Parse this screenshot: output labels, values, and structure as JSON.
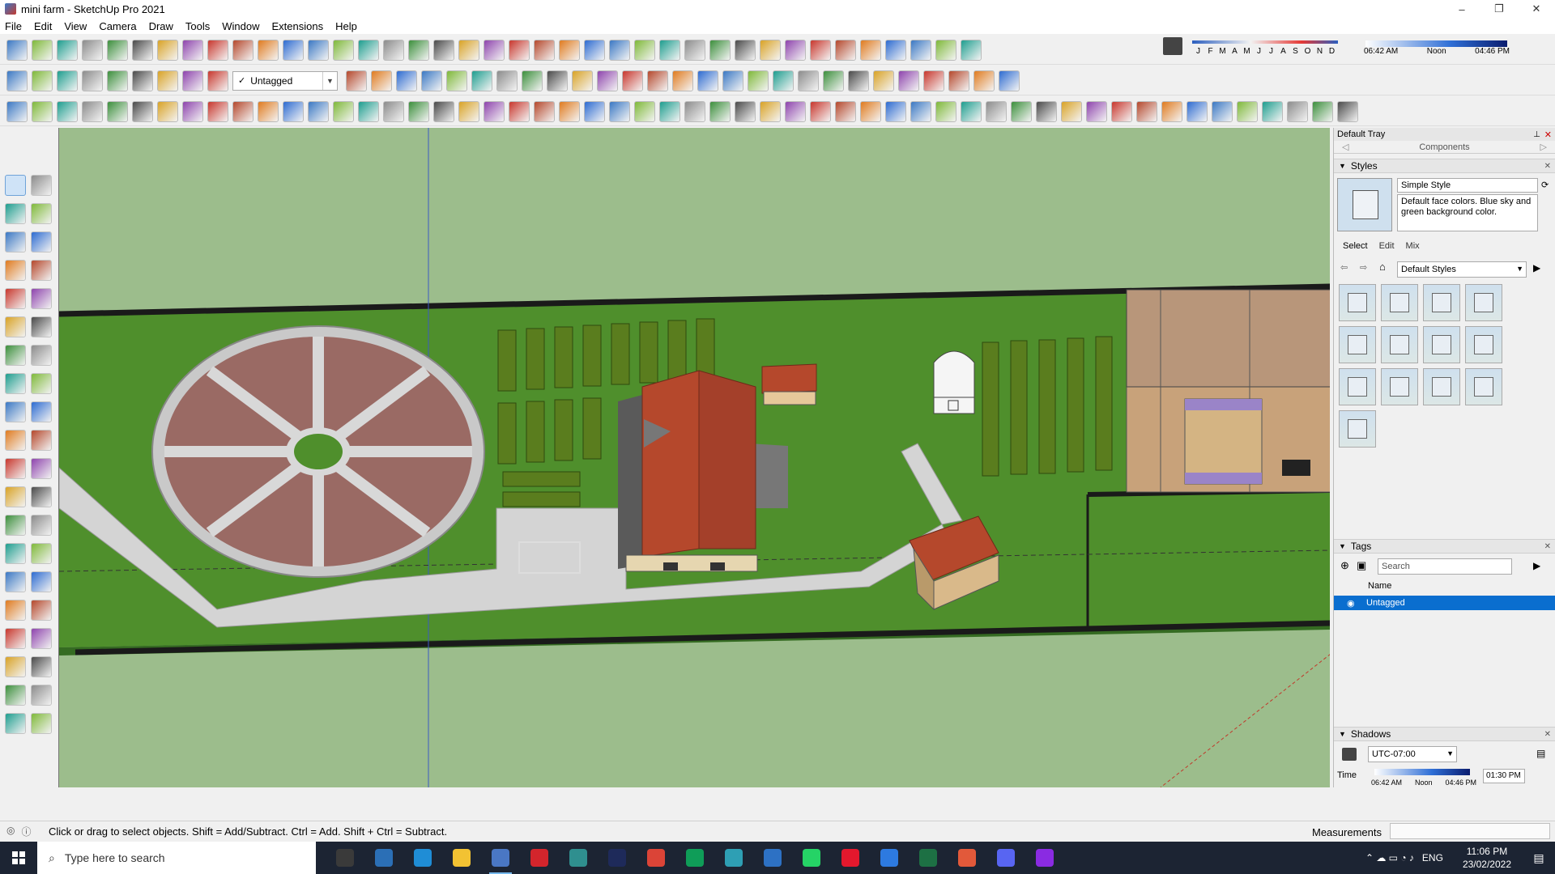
{
  "window": {
    "title": "mini farm - SketchUp Pro 2021",
    "controls": [
      "–",
      "❐",
      "✕"
    ]
  },
  "menu": [
    "File",
    "Edit",
    "View",
    "Camera",
    "Draw",
    "Tools",
    "Window",
    "Extensions",
    "Help"
  ],
  "toolbar": {
    "tag_value": "Untagged"
  },
  "shadow_toolbar": {
    "months": [
      "J",
      "F",
      "M",
      "A",
      "M",
      "J",
      "J",
      "A",
      "S",
      "O",
      "N",
      "D"
    ],
    "time_start": "06:42 AM",
    "time_noon": "Noon",
    "time_end": "04:46 PM"
  },
  "tray": {
    "title": "Default Tray",
    "components_label": "Components",
    "styles": {
      "header": "Styles",
      "name": "Simple Style",
      "description": "Default face colors. Blue sky and green background color.",
      "tabs": [
        "Select",
        "Edit",
        "Mix"
      ],
      "collection": "Default Styles"
    },
    "tags": {
      "header": "Tags",
      "search_placeholder": "Search",
      "column": "Name",
      "rows": [
        "Untagged"
      ]
    },
    "shadows": {
      "header": "Shadows",
      "timezone": "UTC-07:00",
      "time_label": "Time",
      "time_start": "06:42 AM",
      "time_noon": "Noon",
      "time_end": "04:46 PM",
      "time_value": "01:30 PM"
    }
  },
  "status": {
    "message": "Click or drag to select objects. Shift = Add/Subtract. Ctrl = Add. Shift + Ctrl = Subtract.",
    "measurements_label": "Measurements"
  },
  "taskbar": {
    "search_placeholder": "Type here to search",
    "language": "ENG",
    "time": "11:06 PM",
    "date": "23/02/2022"
  },
  "colors": {
    "sky_ground": "#9cbd8c",
    "lawn": "#4f8f2c",
    "roof": "#b5482c",
    "path": "#d4d4d4",
    "selection": "#0a6ecf"
  }
}
